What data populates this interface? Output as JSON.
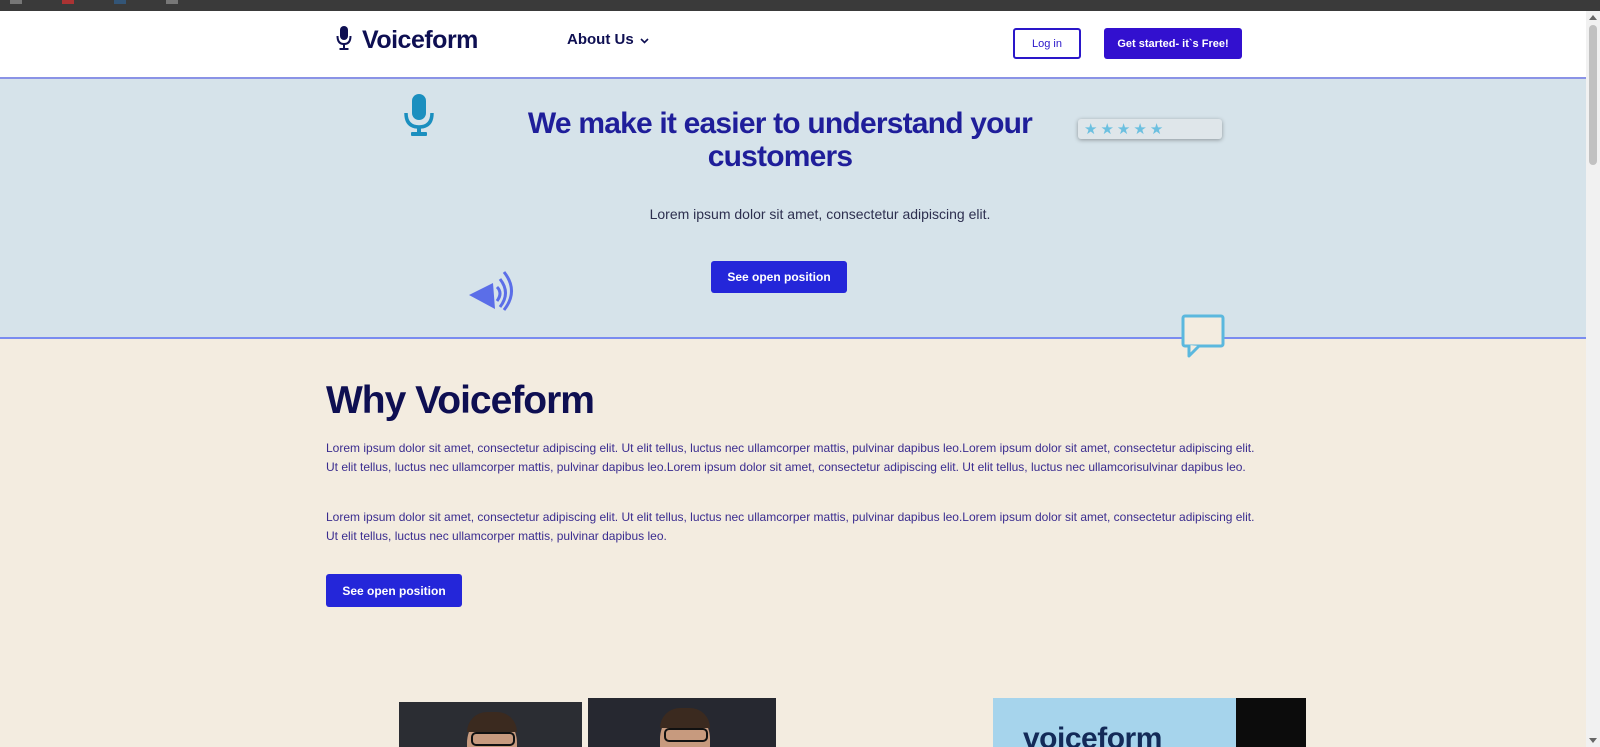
{
  "nav": {
    "logo_text": "Voiceform",
    "about_label": "About Us",
    "login_label": "Log in",
    "cta_label": "Get started- it`s Free!"
  },
  "hero": {
    "title": "We make it easier to understand your customers",
    "subtitle": "Lorem ipsum dolor sit amet, consectetur adipiscing elit.",
    "button_label": "See open position",
    "rating_stars": 5
  },
  "why": {
    "title": "Why Voiceform",
    "paragraph1": "Lorem ipsum dolor sit amet, consectetur adipiscing elit. Ut elit tellus, luctus nec ullamcorper mattis, pulvinar dapibus leo.Lorem ipsum dolor sit amet, consectetur adipiscing elit. Ut elit tellus, luctus nec ullamcorper mattis, pulvinar dapibus leo.Lorem ipsum dolor sit amet, consectetur adipiscing elit. Ut elit tellus, luctus nec ullamcorisulvinar dapibus leo.",
    "paragraph2": "Lorem ipsum dolor sit amet, consectetur adipiscing elit. Ut elit tellus, luctus nec ullamcorper mattis, pulvinar dapibus leo.Lorem ipsum dolor sit amet, consectetur adipiscing elit. Ut elit tellus, luctus nec ullamcorper mattis, pulvinar dapibus leo.",
    "button_label": "See open position"
  },
  "gallery": {
    "brand_photo_text": "voiceform"
  },
  "colors": {
    "brand_navy": "#0e0f52",
    "primary_button": "#2426d9",
    "cta_button": "#3210cf",
    "hero_bg": "#d6e3ea",
    "section_bg": "#f3ece0"
  },
  "icons": [
    "microphone-icon",
    "chevron-down-icon",
    "speaker-icon",
    "star-icon",
    "chat-bubble-icon"
  ]
}
